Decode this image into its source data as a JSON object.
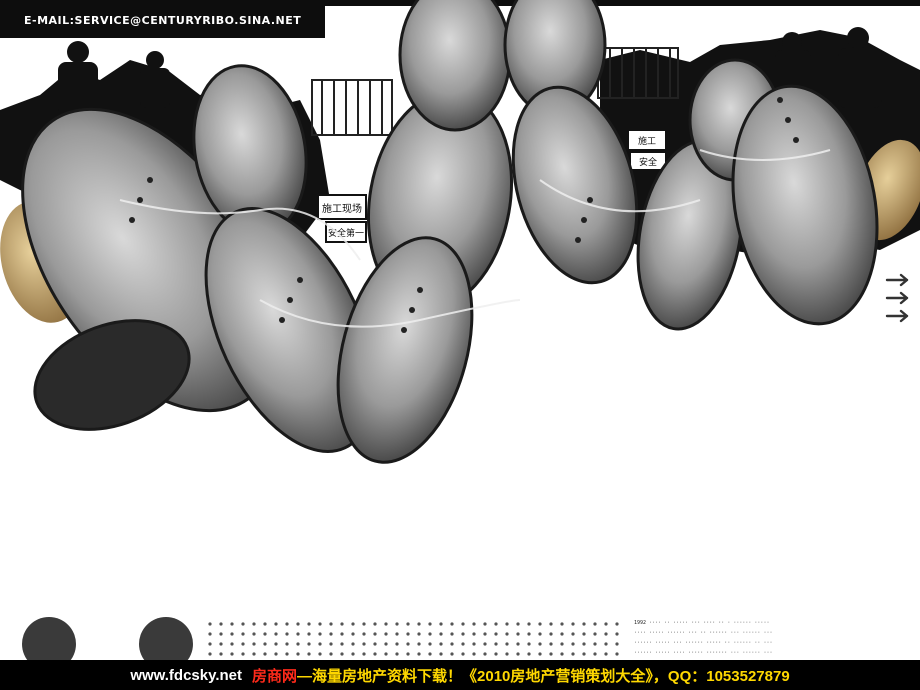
{
  "header": {
    "email_text": "E-MAIL:SERVICE@CENTURYRIBO.SINA.NET"
  },
  "decor": {
    "signs": [
      "施工现场",
      "安全第一",
      "施工",
      "安全"
    ],
    "arrow_icon": "triple-right-arrow-icon"
  },
  "footer": {
    "url": "www.fdcsky.net",
    "brand": "房商网",
    "rest": "—海量房地产资料下载！《2010房地产营销策划大全》，QQ：1053527879"
  },
  "colors": {
    "footer_bg": "#000000",
    "brand": "#ff2a1a",
    "promo": "#ffd800",
    "ink": "#111111",
    "tan_shoe": "#c7ab78"
  }
}
